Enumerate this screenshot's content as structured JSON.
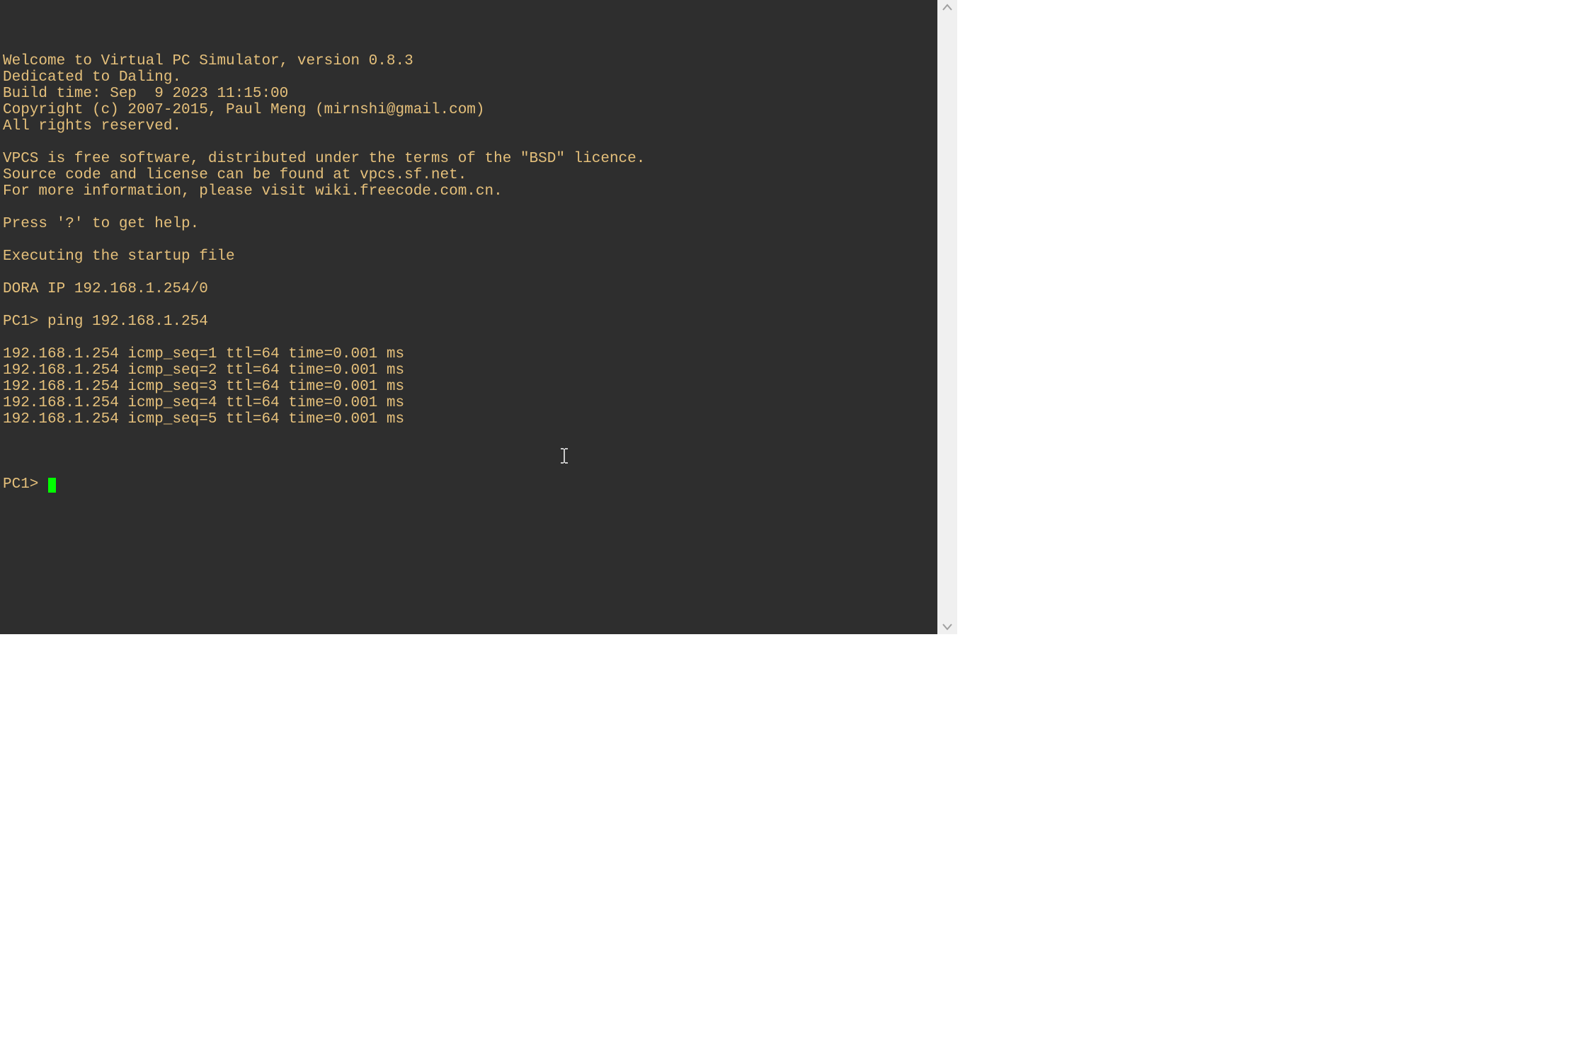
{
  "terminal": {
    "lines": [
      "",
      "Welcome to Virtual PC Simulator, version 0.8.3",
      "Dedicated to Daling.",
      "Build time: Sep  9 2023 11:15:00",
      "Copyright (c) 2007-2015, Paul Meng (mirnshi@gmail.com)",
      "All rights reserved.",
      "",
      "VPCS is free software, distributed under the terms of the \"BSD\" licence.",
      "Source code and license can be found at vpcs.sf.net.",
      "For more information, please visit wiki.freecode.com.cn.",
      "",
      "Press '?' to get help.",
      "",
      "Executing the startup file",
      "",
      "DORA IP 192.168.1.254/0",
      "",
      "PC1> ping 192.168.1.254",
      "",
      "192.168.1.254 icmp_seq=1 ttl=64 time=0.001 ms",
      "192.168.1.254 icmp_seq=2 ttl=64 time=0.001 ms",
      "192.168.1.254 icmp_seq=3 ttl=64 time=0.001 ms",
      "192.168.1.254 icmp_seq=4 ttl=64 time=0.001 ms",
      "192.168.1.254 icmp_seq=5 ttl=64 time=0.001 ms",
      ""
    ],
    "prompt": "PC1> "
  },
  "colors": {
    "terminal_bg": "#2e2e2e",
    "terminal_fg": "#e5c07b",
    "cursor": "#00ff00",
    "scrollbar_bg": "#f0f0f0",
    "scrollbar_arrow": "#a0a0a0"
  }
}
